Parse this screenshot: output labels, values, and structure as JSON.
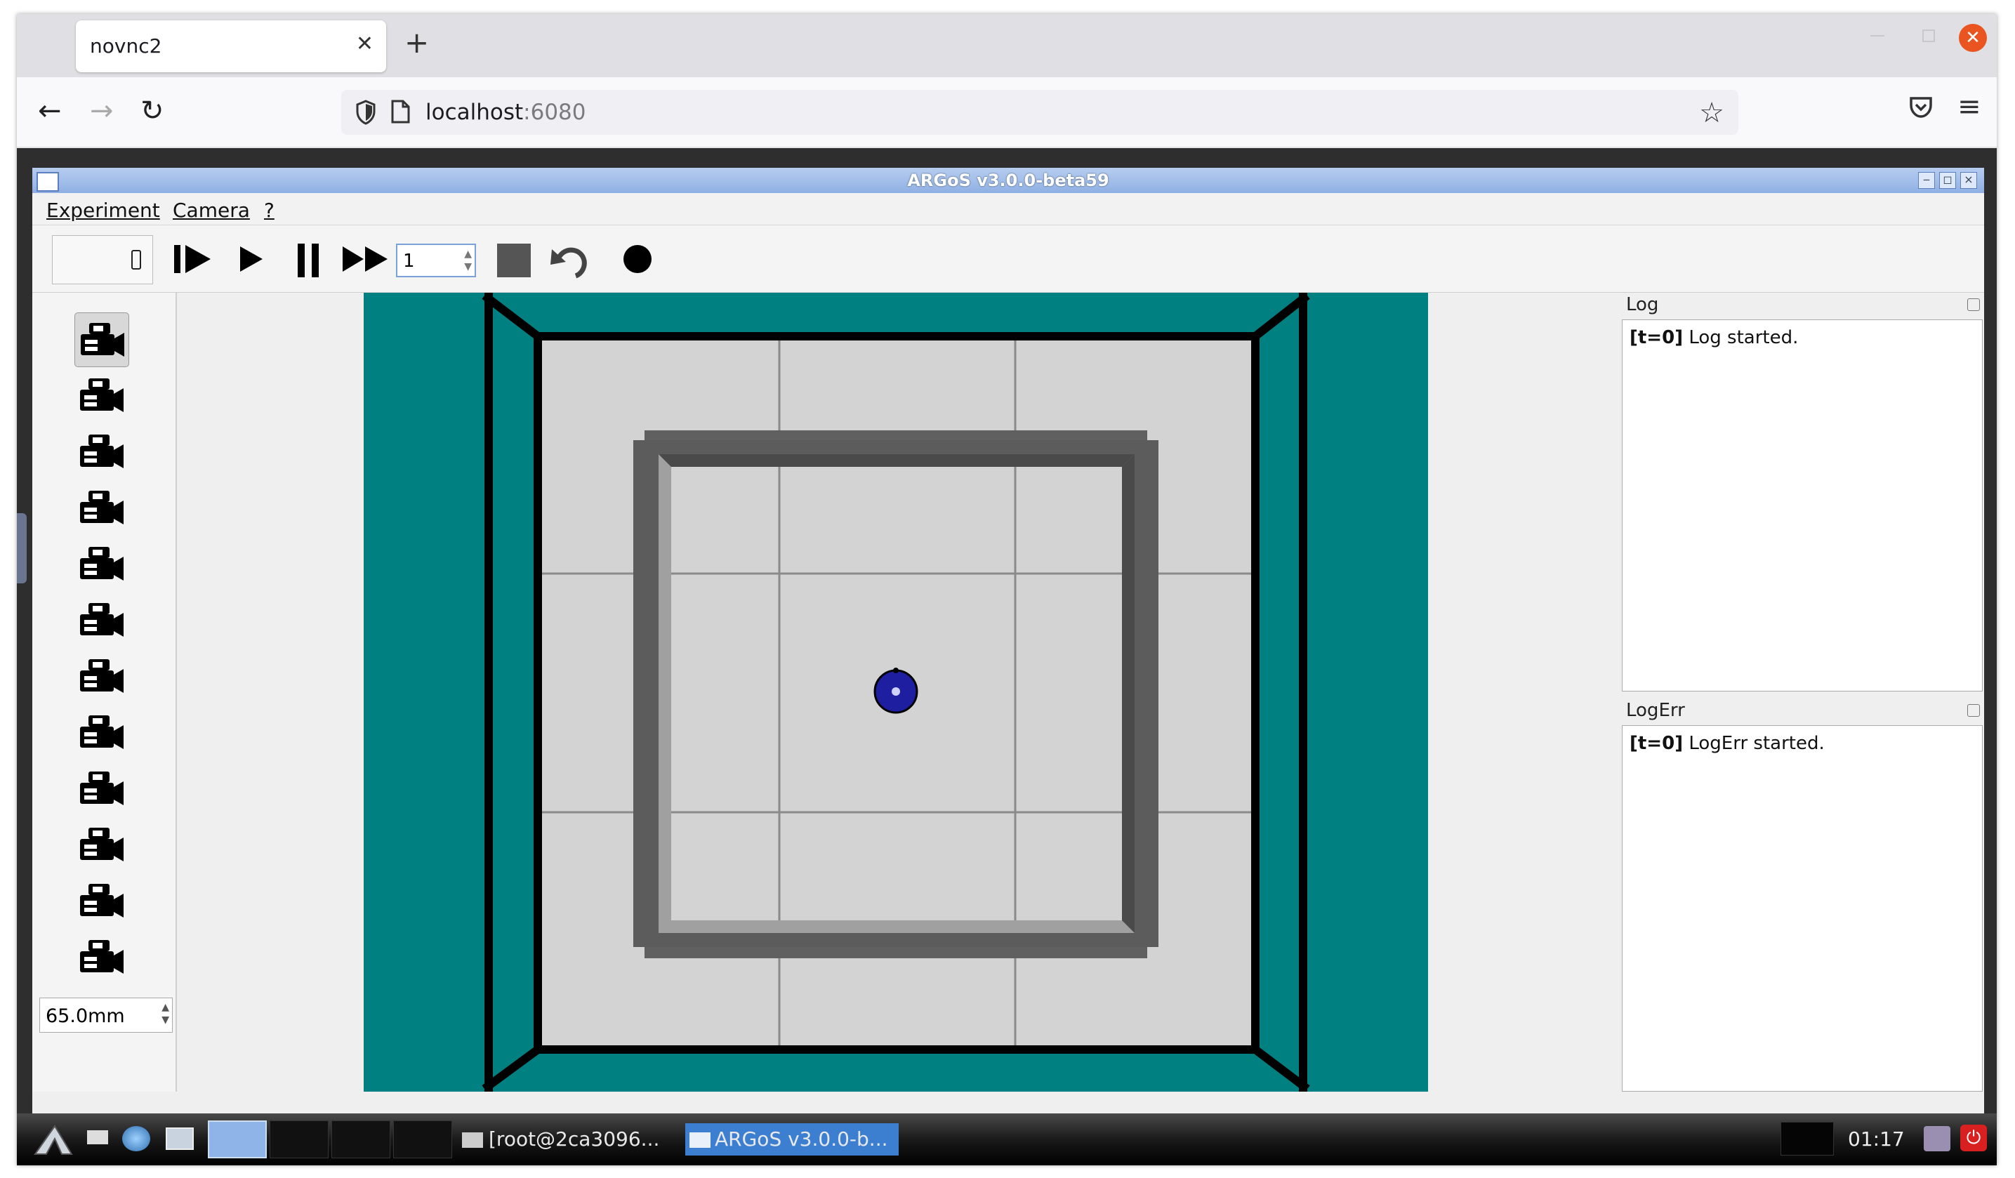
{
  "browser": {
    "tab_title": "novnc2",
    "new_tab_label": "+",
    "url_host": "localhost",
    "url_port": ":6080"
  },
  "argos": {
    "title": "ARGoS v3.0.0-beta59",
    "menu": [
      "Experiment",
      "Camera",
      "?"
    ],
    "steps_value": "1",
    "zoom_value": "65.0mm",
    "log_title": "Log",
    "log_tag": "[t=0]",
    "log_message": " Log started.",
    "logerr_title": "LogErr",
    "logerr_tag": "[t=0]",
    "logerr_message": " LogErr started."
  },
  "taskbar": {
    "task_terminal": "[root@2ca3096...",
    "task_argos": "ARGoS v3.0.0-b...",
    "clock": "01:17"
  },
  "colors": {
    "arena_floor": "#008080",
    "robot": "#1e1ea0",
    "window_titlebar": "#8fb0e4",
    "close_button": "#e95420"
  },
  "icons": {
    "camera": "video-camera-icon",
    "toolbar": [
      "step-icon",
      "play-icon",
      "pause-icon",
      "fast-forward-icon",
      "stop-icon",
      "reset-icon",
      "record-icon"
    ]
  }
}
